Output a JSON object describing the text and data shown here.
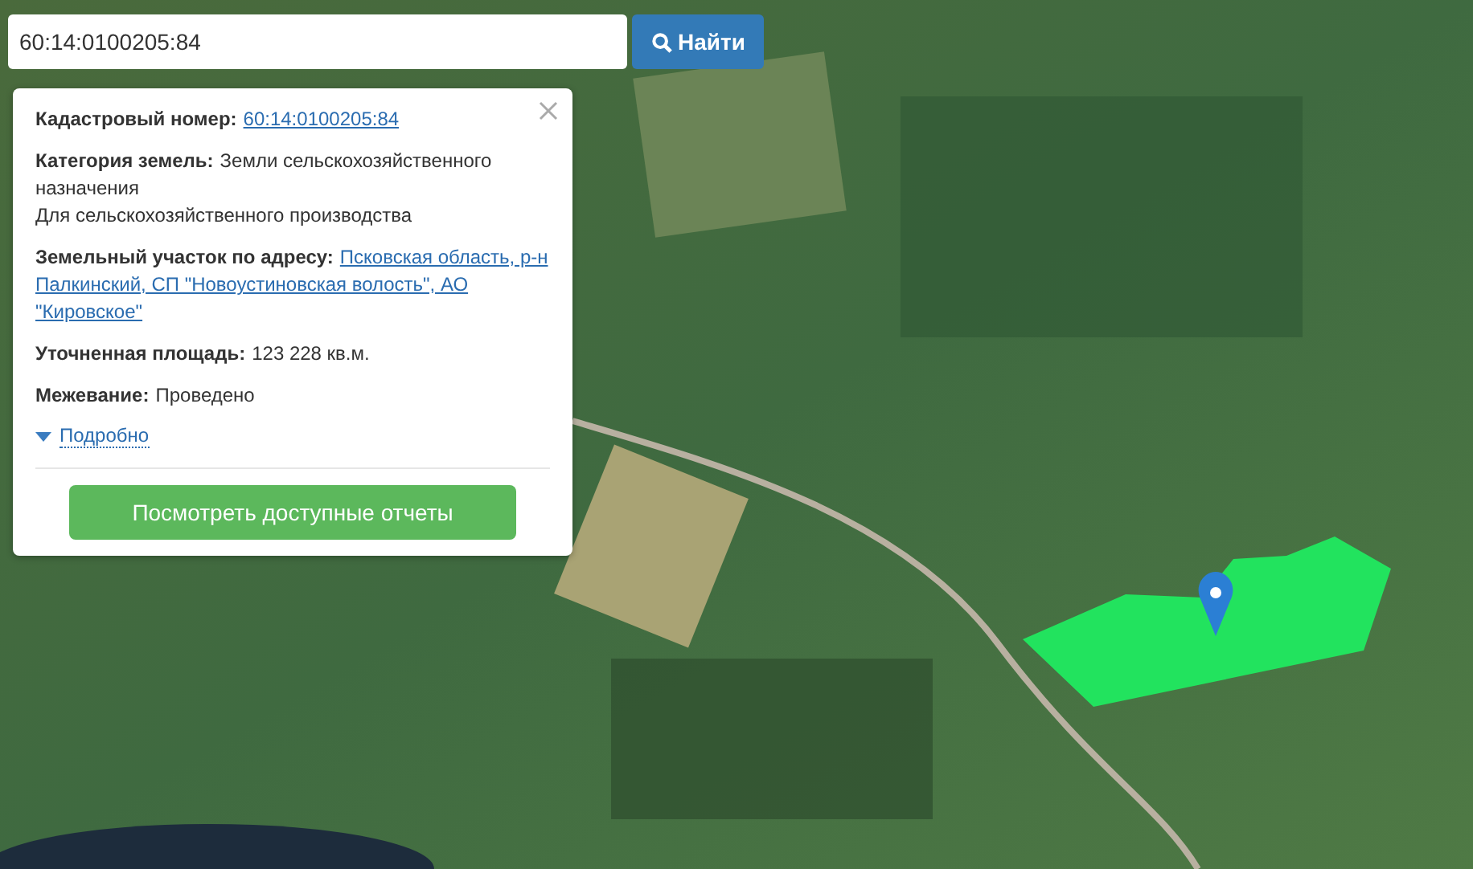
{
  "search": {
    "value": "60:14:0100205:84",
    "button": "Найти"
  },
  "popup": {
    "fields": [
      {
        "label": "Кадастровый номер:",
        "value": "60:14:0100205:84",
        "kind": "link"
      },
      {
        "label": "Категория земель:",
        "value": "Земли сельскохозяйственного назначения",
        "kind": "text",
        "note": "Для сельскохозяйственного производства"
      },
      {
        "label": "Земельный участок по адресу:",
        "value": "Псковская область, р-н Палкинский, СП \"Новоустиновская волость\", АО \"Кировское\"",
        "kind": "link"
      },
      {
        "label": "Уточненная площадь:",
        "value": "123 228 кв.м.",
        "kind": "text"
      },
      {
        "label": "Межевание:",
        "value": "Проведено",
        "kind": "text"
      }
    ],
    "details_link": "Подробно",
    "action_button": "Посмотреть доступные отчеты"
  }
}
